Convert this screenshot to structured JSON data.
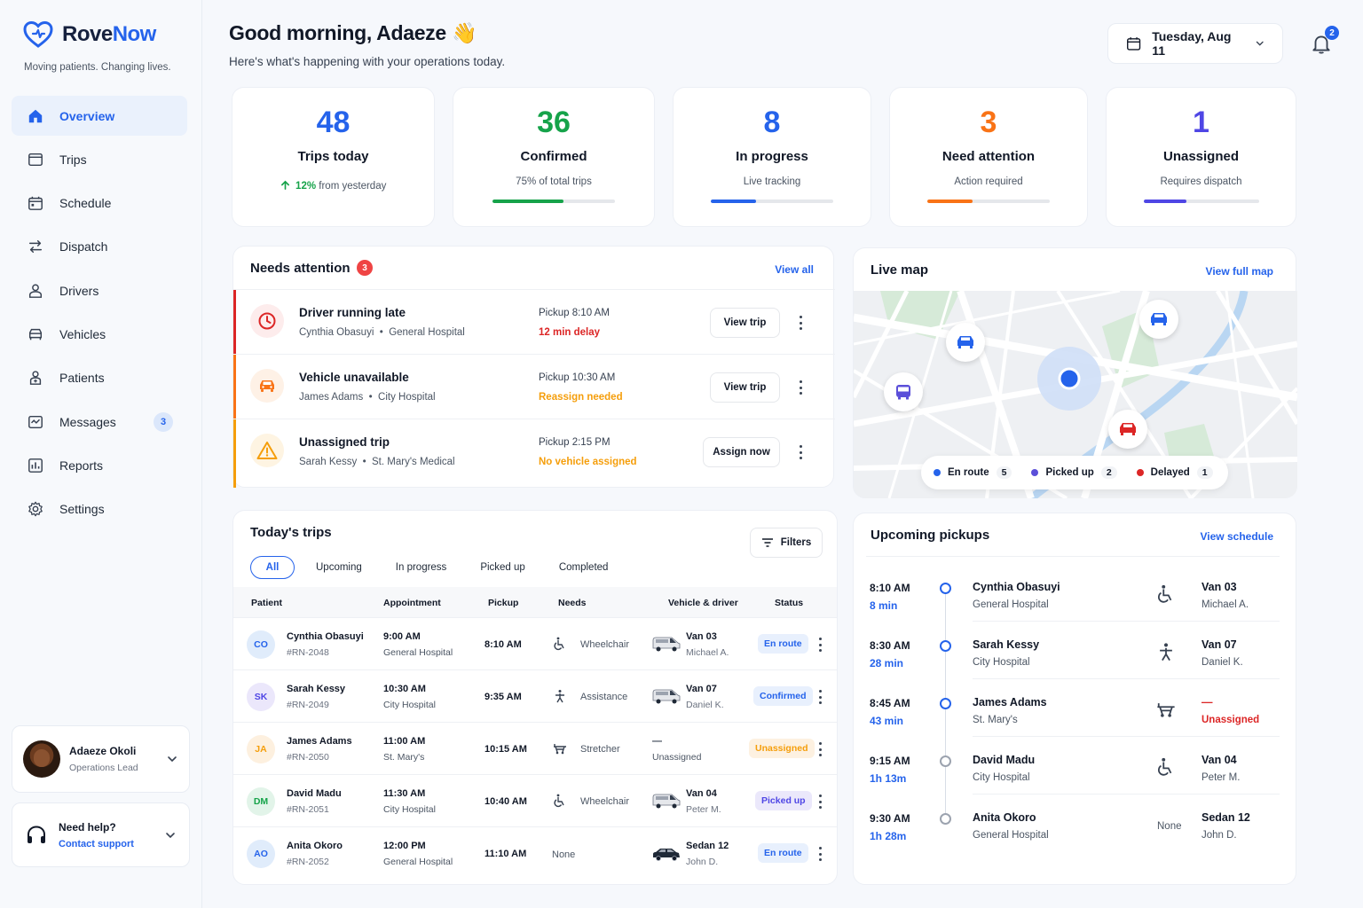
{
  "brand": {
    "name_a": "Rove",
    "name_b": "Now",
    "tagline": "Moving patients. Changing lives."
  },
  "nav": [
    {
      "label": "Overview",
      "icon": "home-icon",
      "active": true
    },
    {
      "label": "Trips",
      "icon": "trips-icon"
    },
    {
      "label": "Schedule",
      "icon": "calendar-icon"
    },
    {
      "label": "Dispatch",
      "icon": "dispatch-icon"
    },
    {
      "label": "Drivers",
      "icon": "driver-icon"
    },
    {
      "label": "Vehicles",
      "icon": "vehicle-icon"
    },
    {
      "label": "Patients",
      "icon": "patient-icon"
    },
    {
      "label": "Messages",
      "icon": "messages-icon",
      "badge": "3"
    },
    {
      "label": "Reports",
      "icon": "reports-icon"
    },
    {
      "label": "Settings",
      "icon": "gear-icon"
    }
  ],
  "user": {
    "name": "Adaeze Okoli",
    "role": "Operations Lead"
  },
  "help": {
    "title": "Need help?",
    "link": "Contact support"
  },
  "header": {
    "greeting": "Good morning, Adaeze",
    "emoji": "👋",
    "subtitle": "Here's what's happening with your operations today.",
    "date": "Tuesday, Aug 11",
    "notifications": "2"
  },
  "stats": [
    {
      "value": "48",
      "label": "Trips today",
      "trend_pct": "12%",
      "trend_text": "from yesterday",
      "color": "#2563eb"
    },
    {
      "value": "36",
      "label": "Confirmed",
      "sub": "75% of total trips",
      "progress": 0.75,
      "color": "#16a34a"
    },
    {
      "value": "8",
      "label": "In progress",
      "sub": "Live tracking",
      "progress": 0.37,
      "color": "#2563eb"
    },
    {
      "value": "3",
      "label": "Need attention",
      "sub": "Action required",
      "progress": 0.37,
      "color": "#f97316"
    },
    {
      "value": "1",
      "label": "Unassigned",
      "sub": "Requires dispatch",
      "progress": 0.37,
      "color": "#4f46e5"
    }
  ],
  "attention": {
    "title": "Needs attention",
    "count": "3",
    "view_all": "View all",
    "items": [
      {
        "title": "Driver running late",
        "patient": "Cynthia Obasuyi",
        "place": "General Hospital",
        "pickup": "Pickup 8:10 AM",
        "status": "12 min delay",
        "action": "View trip",
        "color": "#dc2626"
      },
      {
        "title": "Vehicle unavailable",
        "patient": "James Adams",
        "place": "City Hospital",
        "pickup": "Pickup 10:30 AM",
        "status": "Reassign needed",
        "action": "View trip",
        "color": "#f97316"
      },
      {
        "title": "Unassigned trip",
        "patient": "Sarah Kessy",
        "place": "St. Mary's Medical",
        "pickup": "Pickup 2:15 PM",
        "status": "No vehicle assigned",
        "action": "Assign now",
        "color": "#f59e0b"
      }
    ]
  },
  "map": {
    "title": "Live map",
    "link": "View full map",
    "legend": [
      {
        "label": "En route",
        "count": "5",
        "color": "#2563eb"
      },
      {
        "label": "Picked up",
        "count": "2",
        "color": "#5b4fd9"
      },
      {
        "label": "Delayed",
        "count": "1",
        "color": "#dc2626"
      }
    ]
  },
  "trips": {
    "title": "Today's trips",
    "filters": "Filters",
    "tabs": [
      "All",
      "Upcoming",
      "In progress",
      "Picked up",
      "Completed"
    ],
    "columns": [
      "Patient",
      "Appointment",
      "Pickup",
      "Needs",
      "Vehicle & driver",
      "Status"
    ],
    "rows": [
      {
        "initials": "CO",
        "name": "Cynthia Obasuyi",
        "id": "#RN-2048",
        "appt_time": "9:00 AM",
        "appt_place": "General Hospital",
        "pickup": "8:10 AM",
        "need": "Wheelchair",
        "vehicle": "Van 03",
        "driver": "Michael A.",
        "status": "En route",
        "ini_bg": "#e0ecfb",
        "ini_fg": "#2563eb",
        "pill_bg": "#e8f0fd",
        "pill_fg": "#2563eb"
      },
      {
        "initials": "SK",
        "name": "Sarah Kessy",
        "id": "#RN-2049",
        "appt_time": "10:30 AM",
        "appt_place": "City Hospital",
        "pickup": "9:35 AM",
        "need": "Assistance",
        "vehicle": "Van 07",
        "driver": "Daniel K.",
        "status": "Confirmed",
        "ini_bg": "#ebe7fb",
        "ini_fg": "#4f46e5",
        "pill_bg": "#e8f0fd",
        "pill_fg": "#2563eb"
      },
      {
        "initials": "JA",
        "name": "James Adams",
        "id": "#RN-2050",
        "appt_time": "11:00 AM",
        "appt_place": "St. Mary's",
        "pickup": "10:15 AM",
        "need": "Stretcher",
        "vehicle": "—",
        "driver": "Unassigned",
        "status": "Unassigned",
        "ini_bg": "#fdf0df",
        "ini_fg": "#f59e0b",
        "pill_bg": "#fdf1e1",
        "pill_fg": "#f59e0b"
      },
      {
        "initials": "DM",
        "name": "David Madu",
        "id": "#RN-2051",
        "appt_time": "11:30 AM",
        "appt_place": "City Hospital",
        "pickup": "10:40 AM",
        "need": "Wheelchair",
        "vehicle": "Van 04",
        "driver": "Peter M.",
        "status": "Picked up",
        "ini_bg": "#e2f4e9",
        "ini_fg": "#16a34a",
        "pill_bg": "#ebe8fb",
        "pill_fg": "#4f46e5"
      },
      {
        "initials": "AO",
        "name": "Anita Okoro",
        "id": "#RN-2052",
        "appt_time": "12:00 PM",
        "appt_place": "General Hospital",
        "pickup": "11:10 AM",
        "need": "None",
        "vehicle": "Sedan 12",
        "driver": "John D.",
        "status": "En route",
        "ini_bg": "#e0ecfb",
        "ini_fg": "#2563eb",
        "pill_bg": "#e8f0fd",
        "pill_fg": "#2563eb"
      }
    ]
  },
  "upcoming": {
    "title": "Upcoming pickups",
    "link": "View schedule",
    "items": [
      {
        "time": "8:10 AM",
        "eta": "8 min",
        "name": "Cynthia Obasuyi",
        "place": "General Hospital",
        "need_icon": "wheelchair-icon",
        "vehicle": "Van 03",
        "driver": "Michael A."
      },
      {
        "time": "8:30 AM",
        "eta": "28 min",
        "name": "Sarah Kessy",
        "place": "City Hospital",
        "need_icon": "assistance-icon",
        "vehicle": "Van 07",
        "driver": "Daniel K."
      },
      {
        "time": "8:45 AM",
        "eta": "43 min",
        "name": "James Adams",
        "place": "St. Mary's",
        "need_icon": "stretcher-icon",
        "vehicle": "—",
        "driver": "Unassigned"
      },
      {
        "time": "9:15 AM",
        "eta": "1h 13m",
        "name": "David Madu",
        "place": "City Hospital",
        "need_icon": "wheelchair-icon",
        "vehicle": "Van 04",
        "driver": "Peter M."
      },
      {
        "time": "9:30 AM",
        "eta": "1h 28m",
        "name": "Anita Okoro",
        "place": "General Hospital",
        "need_text": "None",
        "vehicle": "Sedan 12",
        "driver": "John D."
      }
    ]
  }
}
